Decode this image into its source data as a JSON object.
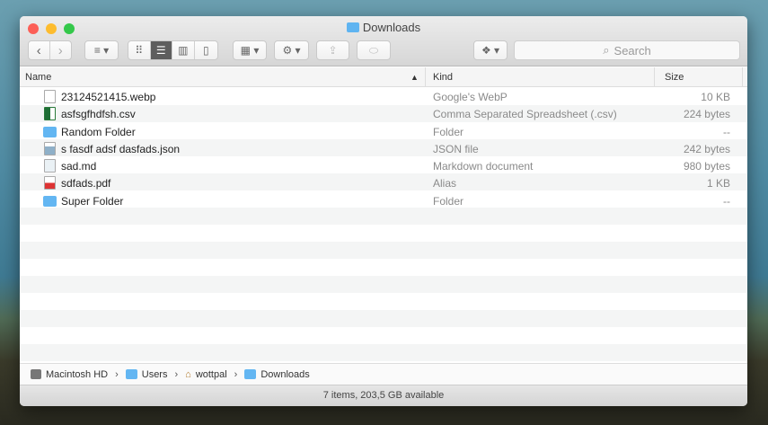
{
  "window": {
    "title": "Downloads"
  },
  "toolbar": {
    "search_placeholder": "Search"
  },
  "columns": {
    "name": "Name",
    "kind": "Kind",
    "size": "Size"
  },
  "files": [
    {
      "name": "23124521415.webp",
      "kind": "Google's WebP",
      "size": "10 KB",
      "icon": "document"
    },
    {
      "name": "asfsgfhdfsh.csv",
      "kind": "Comma Separated Spreadsheet (.csv)",
      "size": "224 bytes",
      "icon": "excel"
    },
    {
      "name": "Random Folder",
      "kind": "Folder",
      "size": "--",
      "icon": "folder"
    },
    {
      "name": "s fasdf adsf dasfads.json",
      "kind": "JSON file",
      "size": "242 bytes",
      "icon": "json"
    },
    {
      "name": "sad.md",
      "kind": "Markdown document",
      "size": "980 bytes",
      "icon": "document"
    },
    {
      "name": "sdfads.pdf",
      "kind": "Alias",
      "size": "1 KB",
      "icon": "pdf"
    },
    {
      "name": "Super Folder",
      "kind": "Folder",
      "size": "--",
      "icon": "folder"
    }
  ],
  "path": [
    "Macintosh HD",
    "Users",
    "wottpal",
    "Downloads"
  ],
  "status": "7 items, 203,5 GB available"
}
